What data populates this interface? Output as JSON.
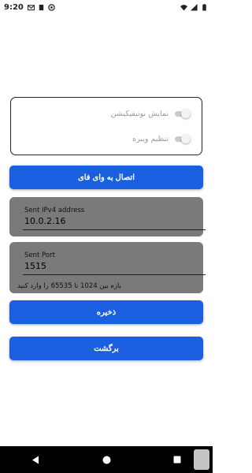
{
  "status_bar": {
    "time": "9:20",
    "left_icons": [
      "gmail-icon",
      "sd-card-icon",
      "vpn-icon"
    ],
    "right_icons": [
      "wifi-icon",
      "signal-icon",
      "battery-icon"
    ]
  },
  "settings": {
    "toggles": [
      {
        "label": "نمایش نوتیفیکیشن",
        "state": "off"
      },
      {
        "label": "تنظیم ویبره",
        "state": "off"
      }
    ]
  },
  "buttons": {
    "wifi_connect": "اتصال به وای فای",
    "save": "ذخیره",
    "back": "برگشت"
  },
  "ip_field": {
    "label": "Sent IPv4 address",
    "value": "10.0.2.16"
  },
  "port_field": {
    "label": "Sent Port",
    "value": "1515",
    "helper": "بازه بین 1024 تا 65535 را وارد کنید"
  },
  "colors": {
    "primary": "#1a5fe0",
    "field_bg": "#7a7a7a",
    "nav_bar": "#000000"
  },
  "nav_bar": {
    "icons": [
      "back-icon",
      "home-icon",
      "recents-icon"
    ]
  }
}
